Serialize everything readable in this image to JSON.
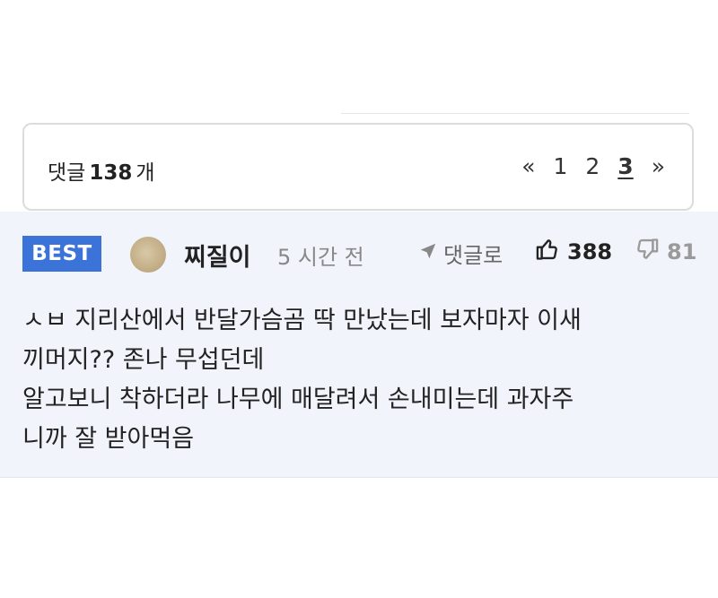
{
  "comments_header": {
    "label": "댓글",
    "count": "138",
    "unit": "개"
  },
  "pagination": {
    "prev": "«",
    "pages": [
      "1",
      "2",
      "3"
    ],
    "current": "3",
    "next": "»"
  },
  "best_comment": {
    "badge": "BEST",
    "author": "찌질이",
    "time": "5 시간 전",
    "reply_label": "댓글로",
    "likes": "388",
    "dislikes": "81",
    "body_lines": [
      "ㅅㅂ 지리산에서 반달가슴곰 딱 만났는데 보자마자 이새",
      "끼머지?? 존나 무섭던데",
      "알고보니 착하더라 나무에 매달려서 손내미는데 과자주",
      "니까 잘 받아먹음"
    ]
  },
  "colors": {
    "badge_bg": "#3b73d8",
    "comment_bg": "#f2f4fc"
  },
  "icons": {
    "reply": "paper-plane-icon",
    "like": "thumbs-up-icon",
    "dislike": "thumbs-down-icon"
  }
}
